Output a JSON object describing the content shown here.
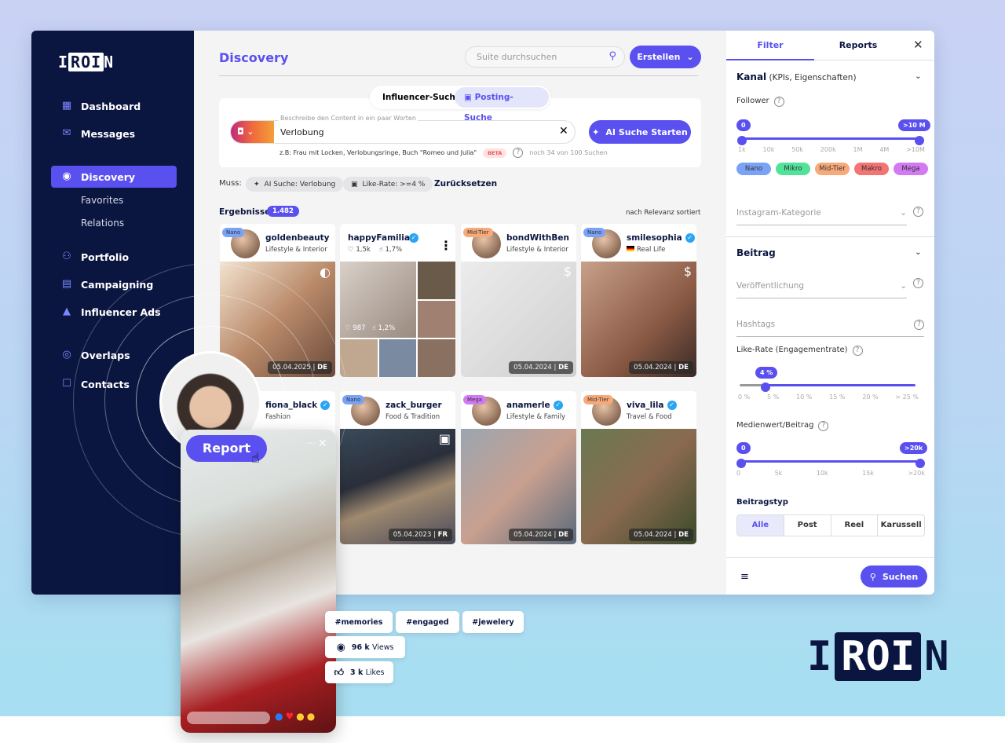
{
  "brand": {
    "logo": "IROIN"
  },
  "sidebar": {
    "items": [
      {
        "label": "Dashboard",
        "icon": "dashboard-icon"
      },
      {
        "label": "Messages",
        "icon": "mail-icon"
      },
      {
        "label": "Discovery",
        "icon": "eye-icon",
        "active": true
      },
      {
        "label": "Favorites"
      },
      {
        "label": "Relations"
      },
      {
        "label": "Portfolio",
        "icon": "users-icon"
      },
      {
        "label": "Campaigning",
        "icon": "file-icon"
      },
      {
        "label": "Influencer Ads",
        "icon": "rocket-icon"
      },
      {
        "label": "Overlaps",
        "icon": "overlap-icon"
      },
      {
        "label": "Contacts",
        "icon": "contact-icon"
      }
    ]
  },
  "header": {
    "title": "Discovery",
    "search_placeholder": "Suite durchsuchen",
    "create_label": "Erstellen"
  },
  "search_tabs": [
    "Influencer-Suche",
    "Posting-Suche"
  ],
  "ai_search": {
    "field_label": "Beschreibe den Content in ein paar Worten",
    "value": "Verlobung",
    "button": "AI Suche Starten",
    "hint": "z.B: Frau mit Locken, Verlobungsringe, Buch \"Romeo und Julia\"",
    "beta": "BETA",
    "quota": "noch 34 von 100 Suchen"
  },
  "filters_applied": {
    "label": "Muss:",
    "chips": [
      "AI Suche: Verlobung",
      "Like-Rate: >=4 %"
    ],
    "reset": "Zurücksetzen"
  },
  "results": {
    "label": "Ergebnisse",
    "count": "1.482",
    "sort": "nach Relevanz sortiert"
  },
  "cards": [
    {
      "name": "goldenbeauty",
      "category": "Lifestyle & Interior",
      "tier": "Nano",
      "date": "05.04.2025",
      "country": "DE",
      "verified": false
    },
    {
      "name": "happyFamilia",
      "likes": "1,5k",
      "rate": "1,7%",
      "verified": true,
      "inner_likes": "987",
      "inner_rate": "1,2%"
    },
    {
      "name": "bondWithBen",
      "category": "Lifestyle & Interior",
      "tier": "Mid-Tier",
      "date": "05.04.2024",
      "country": "DE",
      "verified": false
    },
    {
      "name": "smilesophia",
      "category": "Real Life",
      "tier": "Nano",
      "date": "05.04.2024",
      "country": "DE",
      "verified": true
    },
    {
      "name": "fiona_black",
      "category": "Fashion",
      "verified": true
    },
    {
      "name": "zack_burger",
      "category": "Food & Tradition",
      "tier": "Nano",
      "date": "05.04.2023",
      "country": "FR",
      "verified": false
    },
    {
      "name": "anamerle",
      "category": "Lifestyle & Family",
      "tier": "Mega",
      "date": "05.04.2024",
      "country": "DE",
      "verified": true
    },
    {
      "name": "viva_lila",
      "category": "Travel & Food",
      "tier": "Mid-Tier",
      "date": "05.04.2024",
      "country": "DE",
      "verified": true
    }
  ],
  "panel": {
    "tabs": [
      "Filter",
      "Reports"
    ],
    "kanal": {
      "title": "Kanal",
      "subtitle": "(KPIs, Eigenschaften)"
    },
    "follower": {
      "label": "Follower",
      "min": "0",
      "max": ">10 M",
      "ticks": [
        "1k",
        "10k",
        "50k",
        "200k",
        "1M",
        "4M",
        ">10M"
      ]
    },
    "tiers": [
      {
        "label": "Nano",
        "color": "#7aa2f7"
      },
      {
        "label": "Mikro",
        "color": "#52e39a"
      },
      {
        "label": "Mid-Tier",
        "color": "#f7a97a"
      },
      {
        "label": "Makro",
        "color": "#f47474"
      },
      {
        "label": "Mega",
        "color": "#d17af2"
      }
    ],
    "instagram_category": "Instagram-Kategorie",
    "beitrag": "Beitrag",
    "veroeffentlichung": "Veröffentlichung",
    "hashtags": "Hashtags",
    "like_rate": {
      "label": "Like-Rate (Engagementrate)",
      "value": "4 %",
      "value_num": 4,
      "ticks": [
        "0 %",
        "5 %",
        "10 %",
        "15 %",
        "20 %",
        "> 25 %"
      ]
    },
    "medienwert": {
      "label": "Medienwert/Beitrag",
      "min": "0",
      "max": ">20k",
      "ticks": [
        "0",
        "5k",
        "10k",
        "15k",
        ">20k"
      ]
    },
    "beitragstyp": {
      "label": "Beitragstyp",
      "options": [
        "Alle",
        "Post",
        "Reel",
        "Karussell"
      ],
      "selected": "Alle"
    },
    "search_button": "Suchen"
  },
  "report_overlay": {
    "button": "Report",
    "hashtags": [
      "#memories",
      "#engaged",
      "#jewelery"
    ],
    "views": "96 k",
    "views_label": "Views",
    "likes": "3 k",
    "likes_label": "Likes"
  },
  "colors": {
    "accent": "#5a50f0",
    "navy": "#0b1640"
  }
}
